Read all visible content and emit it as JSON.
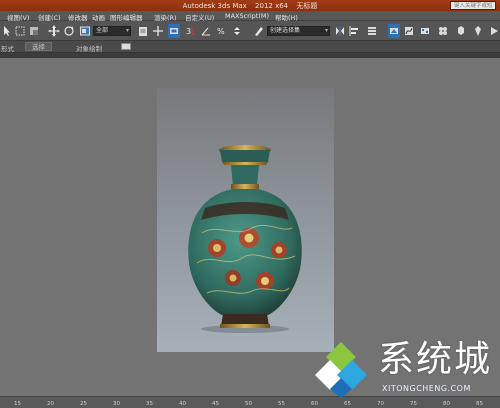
{
  "window": {
    "app_title": "Autodesk 3ds Max",
    "version": "2012 x64",
    "doc_title": "无标题",
    "search_placeholder": "键入关键字或短语"
  },
  "menu": [
    "视图(V)",
    "创建(C)",
    "修改器",
    "动画",
    "图形编辑器",
    "渲染(R)",
    "自定义(U)",
    "MAXScript(M)",
    "帮助(H)"
  ],
  "toolbar": {
    "selection_filter": "全部",
    "named_selection": "创建选择集"
  },
  "ribbon": {
    "tab_left": "形式",
    "tab_selection": "选择",
    "tab_object_paint": "对象绘制"
  },
  "timeline": {
    "ticks": [
      "15",
      "20",
      "25",
      "30",
      "35",
      "40",
      "45",
      "50",
      "55",
      "60",
      "65",
      "70",
      "75",
      "80",
      "85"
    ]
  },
  "watermark": {
    "name": "系统城",
    "domain": "XITONGCHENG.COM"
  },
  "colors": {
    "title_bar": "#8a2f0d",
    "active_tool": "#2f6fb7",
    "viewport_bg": "#737373"
  }
}
